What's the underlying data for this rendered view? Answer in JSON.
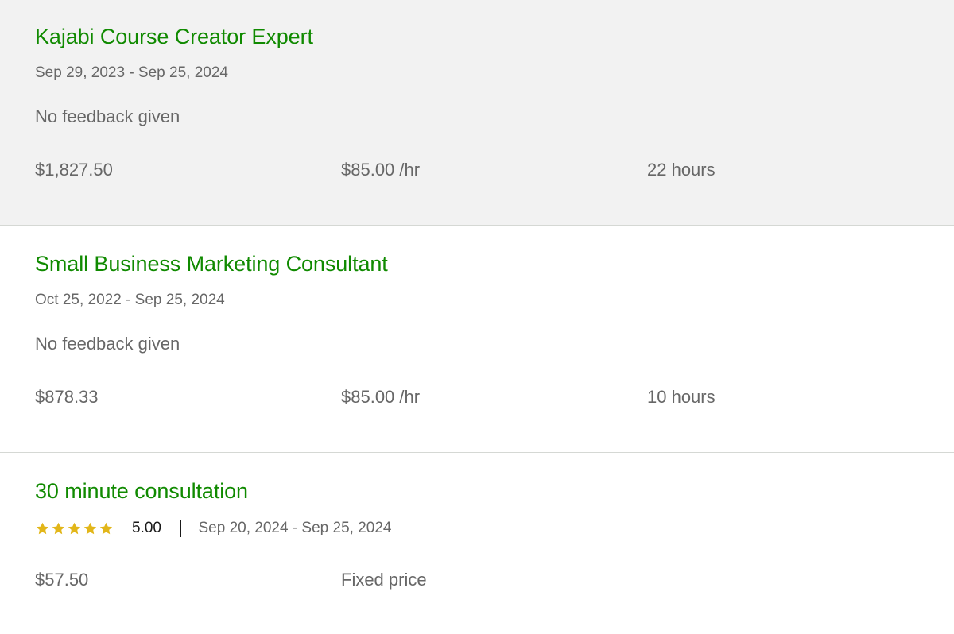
{
  "colors": {
    "title": "#108a00",
    "text": "#676767",
    "star": "#e2b619",
    "highlight_bg": "#f2f2f2",
    "divider": "#d5d8d4"
  },
  "jobs": [
    {
      "title": "Kajabi Course Creator Expert",
      "dates": "Sep 29, 2023 - Sep 25, 2024",
      "feedback": "No feedback given",
      "earned": "$1,827.50",
      "rate": "$85.00 /hr",
      "hours": "22 hours"
    },
    {
      "title": "Small Business Marketing Consultant",
      "dates": "Oct 25, 2022 - Sep 25, 2024",
      "feedback": "No feedback given",
      "earned": "$878.33",
      "rate": "$85.00 /hr",
      "hours": "10 hours"
    },
    {
      "title": "30 minute consultation",
      "rating": "5.00",
      "rating_stars": 5,
      "dates": "Sep 20, 2024 - Sep 25, 2024",
      "earned": "$57.50",
      "price_type": "Fixed price"
    }
  ],
  "icons": {
    "star": "star-icon"
  }
}
